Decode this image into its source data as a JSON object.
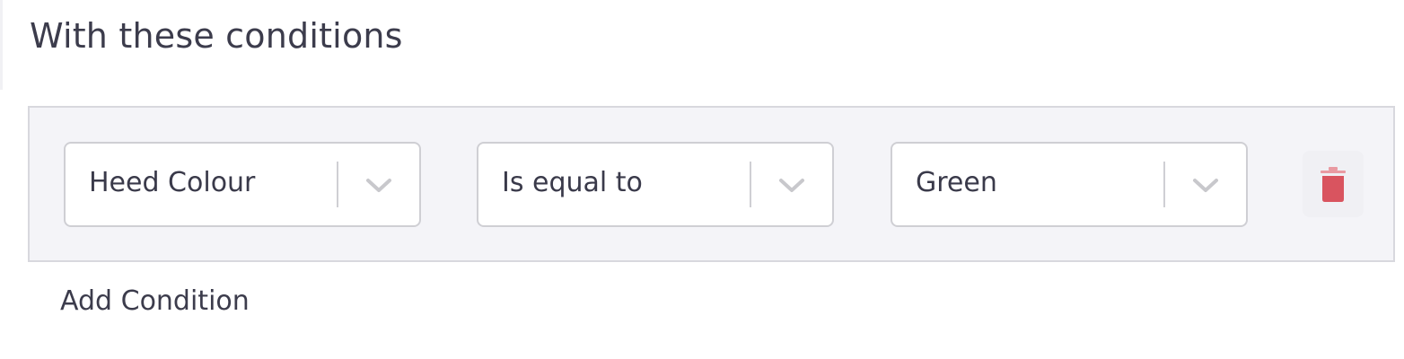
{
  "section": {
    "title": "With these conditions"
  },
  "conditions": [
    {
      "field": "Heed Colour",
      "operator": "Is equal to",
      "value": "Green"
    }
  ],
  "actions": {
    "add_condition_label": "Add Condition"
  },
  "icons": {
    "chevron": "chevron-down-icon",
    "delete": "trash-icon"
  },
  "colors": {
    "text": "#3a3a4a",
    "row_background": "#f4f4f8",
    "border": "#cfcfd4",
    "chevron": "#c8c8cc",
    "delete": "#d9545f"
  }
}
